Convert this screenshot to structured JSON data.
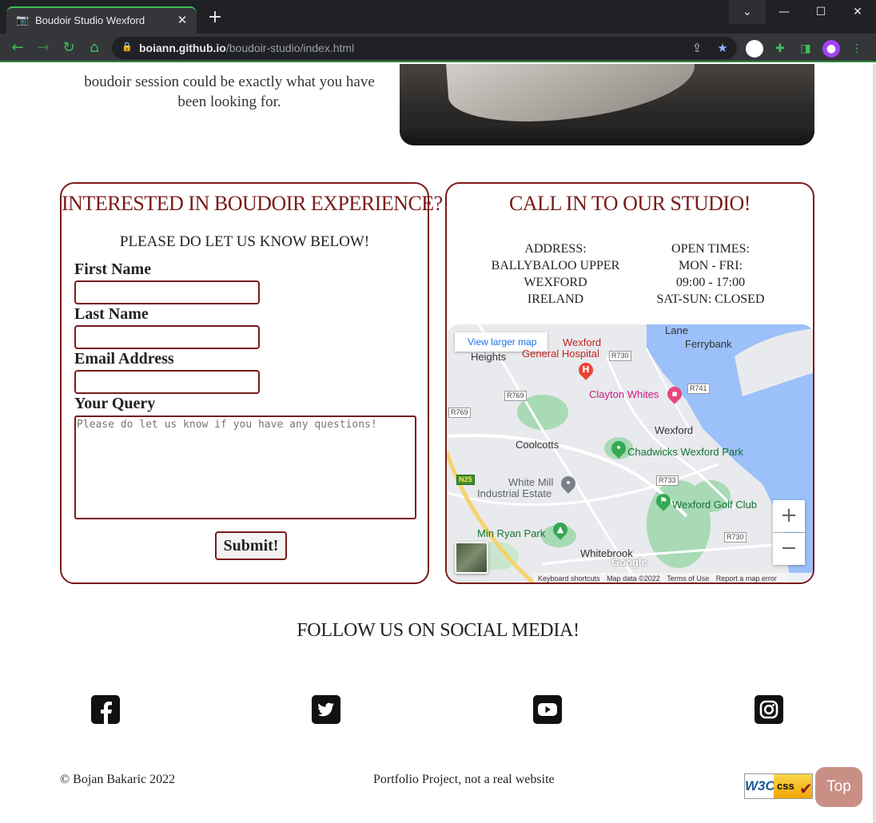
{
  "browser": {
    "tab_title": "Boudoir Studio Wexford",
    "tab_close": "✕",
    "new_tab": "+",
    "url_domain": "boiann.github.io",
    "url_path": "/boudoir-studio/index.html",
    "window_controls": {
      "dropdown": "⌄",
      "minimize": "—",
      "maximize": "☐",
      "close": "✕"
    },
    "nav": {
      "back": "←",
      "forward": "→",
      "reload": "↻",
      "home": "⌂"
    },
    "icons": [
      "share-icon",
      "bookmark-star-icon",
      "profile-circle-icon",
      "extensions-puzzle-icon",
      "side-panel-icon",
      "avatar-icon",
      "menu-dots-icon"
    ]
  },
  "intro": {
    "text_line1": "boudoir session could be exactly what you have",
    "text_line2": "been looking for."
  },
  "form_card": {
    "title": "INTERESTED IN BOUDOIR EXPERIENCE?",
    "subtitle": "PLEASE DO LET US KNOW BELOW!",
    "first_name_label": "First Name",
    "last_name_label": "Last Name",
    "email_label": "Email Address",
    "query_label": "Your Query",
    "query_placeholder": "Please do let us know if you have any questions!",
    "submit_label": "Submit!"
  },
  "studio_card": {
    "title": "CALL IN TO OUR STUDIO!",
    "address": [
      "ADDRESS:",
      "BALLYBALOO UPPER",
      "WEXFORD",
      "IRELAND"
    ],
    "open_times": [
      "OPEN TIMES:",
      "MON - FRI:",
      "09:00 - 17:00",
      "SAT-SUN: CLOSED"
    ]
  },
  "map": {
    "view_larger": "View larger map",
    "labels": {
      "lane": "Lane",
      "ferrybank": "Ferrybank",
      "wexford_hospital_1": "Wexford",
      "wexford_hospital_2": "General Hospital",
      "heights": "Heights",
      "clayton": "Clayton Whites",
      "wexford": "Wexford",
      "coolcotts": "Coolcotts",
      "chadwicks": "Chadwicks Wexford Park",
      "white_mill_1": "White Mill",
      "white_mill_2": "Industrial Estate",
      "golf": "Wexford Golf Club",
      "min_ryan": "Min Ryan Park",
      "whitebrook": "Whitebrook"
    },
    "roads": {
      "r730a": "R730",
      "r741": "R741",
      "r769a": "R769",
      "r769b": "R769",
      "n25": "N25",
      "r733": "R733",
      "r730b": "R730"
    },
    "zoom_in": "+",
    "zoom_out": "−",
    "google": "Google",
    "footer": {
      "shortcuts": "Keyboard shortcuts",
      "data": "Map data ©2022",
      "terms": "Terms of Use",
      "report": "Report a map error"
    }
  },
  "social": {
    "title": "FOLLOW US ON SOCIAL MEDIA!",
    "icons": [
      "facebook-icon",
      "twitter-icon",
      "youtube-icon",
      "instagram-icon"
    ]
  },
  "footer": {
    "copyright": "© Bojan Bakaric 2022",
    "disclaimer": "Portfolio Project, not a real website",
    "w3c_left": "W3C",
    "w3c_right": "css",
    "top_button": "Top"
  },
  "colors": {
    "accent": "#7a1a1a",
    "top_button": "#c98f85",
    "map_water": "#9cc0f9",
    "map_green": "#a8dab5"
  }
}
